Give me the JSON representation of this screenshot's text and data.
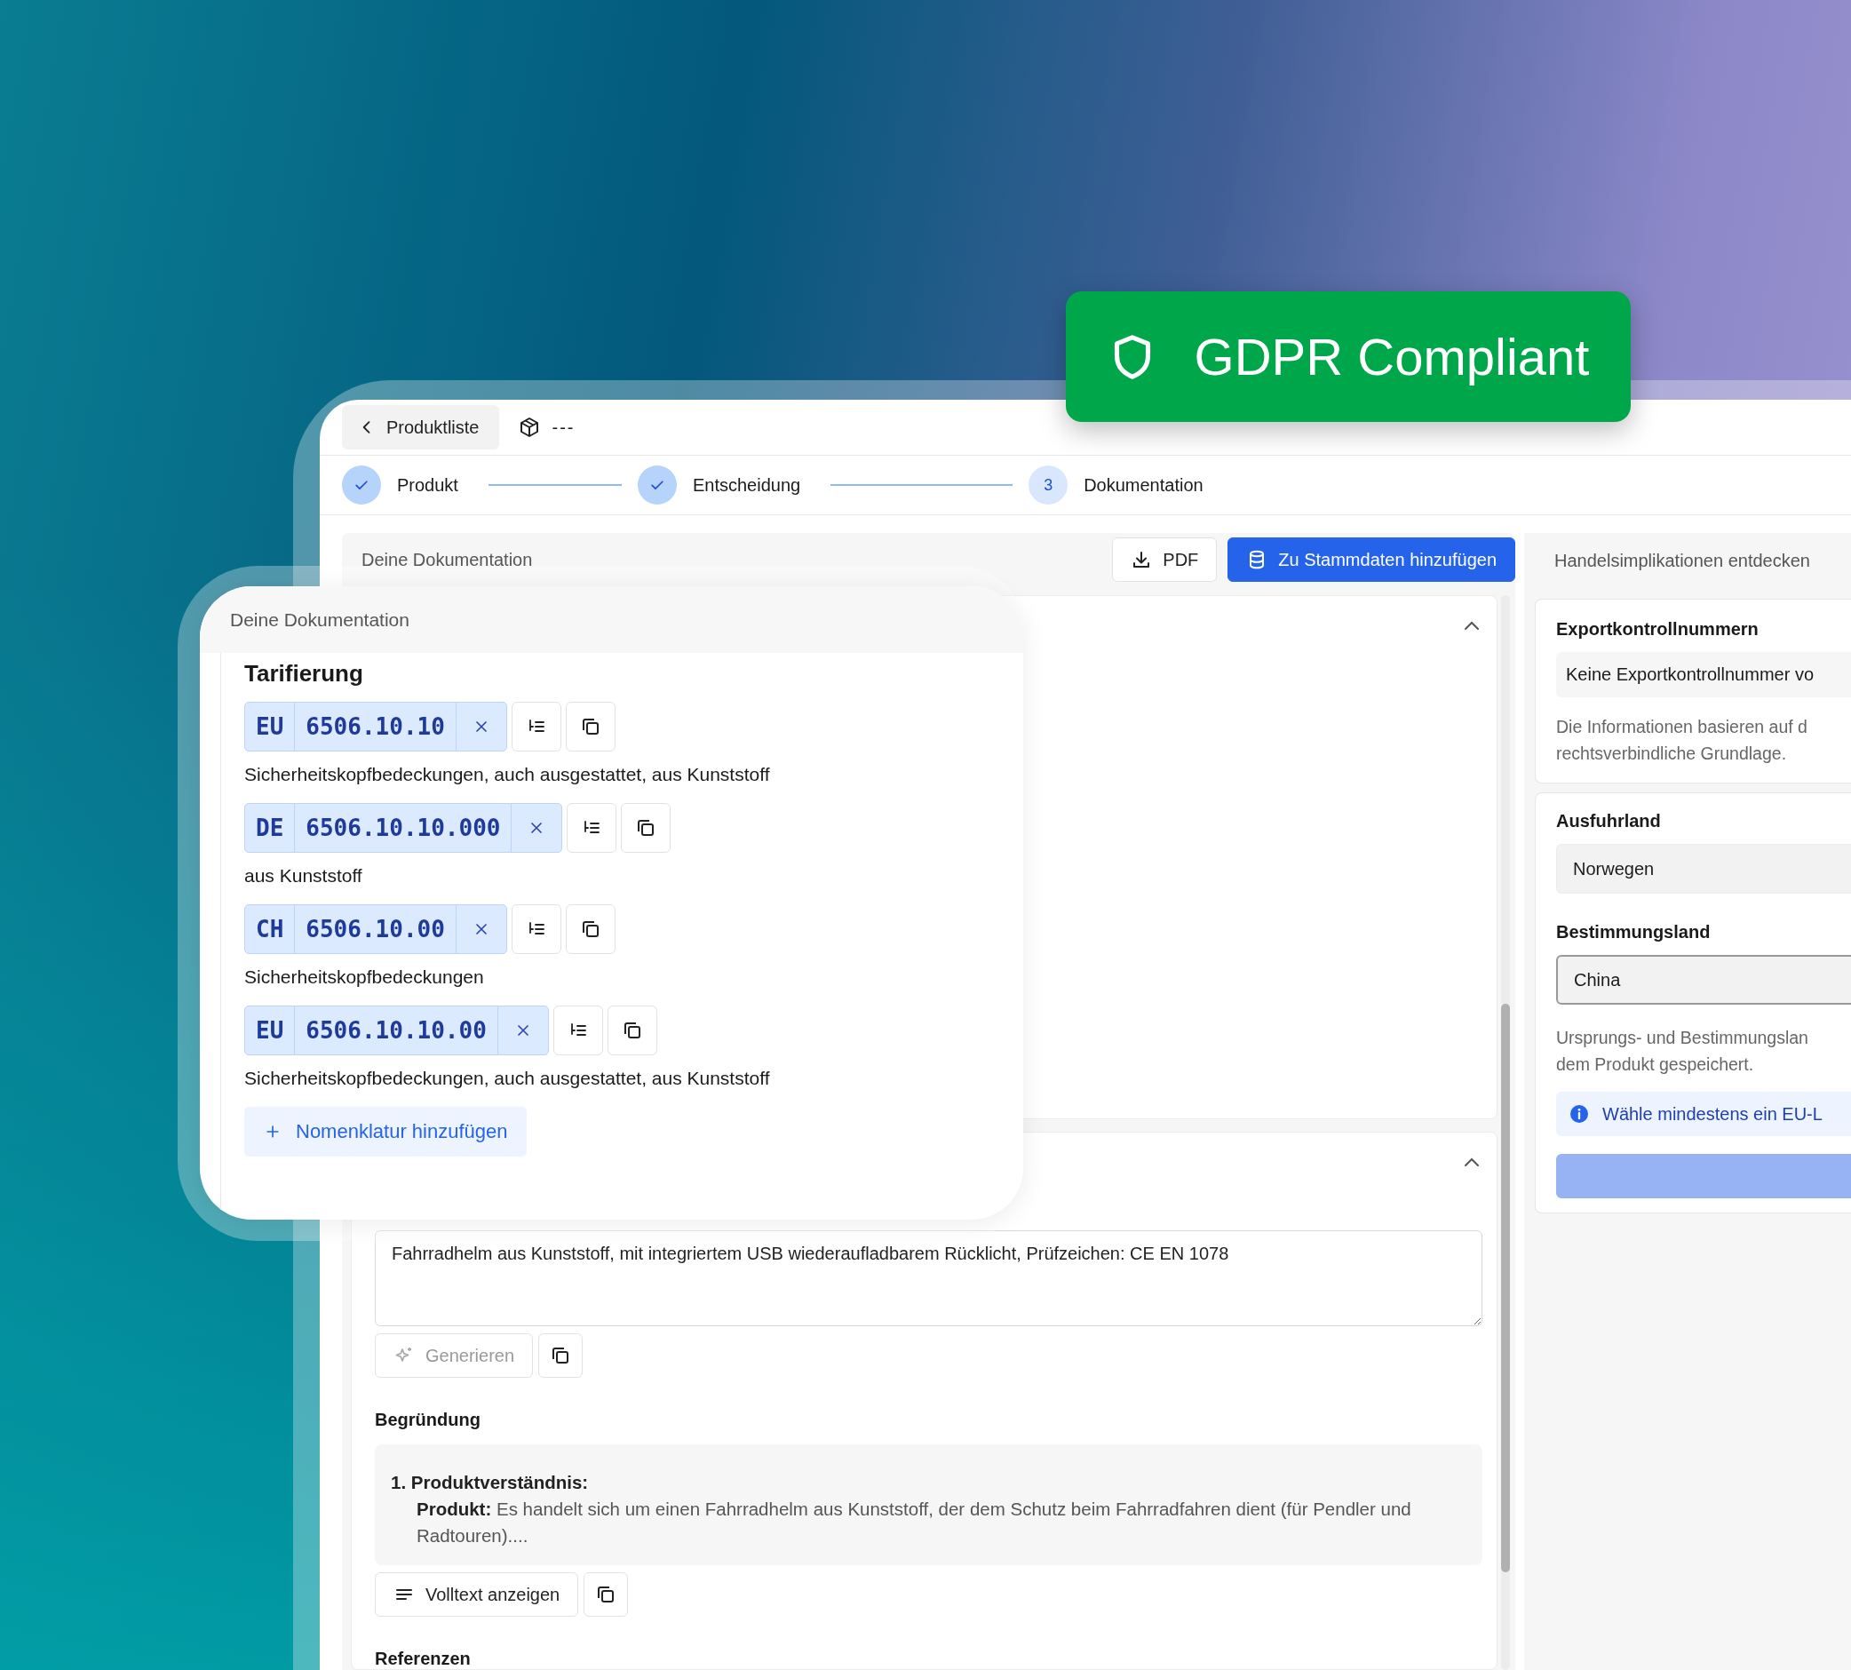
{
  "badge": {
    "label": "GDPR Compliant"
  },
  "header": {
    "back_label": "Produktliste",
    "product_name": "---"
  },
  "stepper": [
    {
      "label": "Produkt",
      "done": true
    },
    {
      "label": "Entscheidung",
      "done": true
    },
    {
      "label": "Dokumentation",
      "done": false,
      "number": "3"
    }
  ],
  "documentation": {
    "title": "Deine Dokumentation",
    "pdf_button": "PDF",
    "save_button": "Zu Stammdaten hinzufügen",
    "description_field": {
      "value": "Fahrradhelm aus Kunststoff, mit integriertem USB wiederaufladbarem Rücklicht, Prüfzeichen: CE EN 1078"
    },
    "generate_button": {
      "label": "Generieren",
      "disabled": true
    },
    "reasoning": {
      "label": "Begründung",
      "heading": "1. Produktverständnis:",
      "text": "**Produkt:** Es handelt sich um einen Fahrradhelm aus Kunststoff, der dem Schutz beim Fahrradfahren dient (für Pendler und Radtouren)....",
      "show_full_button": "Volltext anzeigen"
    },
    "references_label": "Referenzen"
  },
  "overlay": {
    "title": "Deine Dokumentation",
    "section_title": "Tarifierung",
    "codes": [
      {
        "region": "EU",
        "code": "6506.10.10",
        "description": "Sicherheitskopfbedeckungen, auch ausgestattet, aus Kunststoff"
      },
      {
        "region": "DE",
        "code": "6506.10.10.000",
        "description": "aus Kunststoff"
      },
      {
        "region": "CH",
        "code": "6506.10.00",
        "description": "Sicherheitskopfbedeckungen"
      },
      {
        "region": "EU",
        "code": "6506.10.10.00",
        "description": "Sicherheitskopfbedeckungen, auch ausgestattet, aus Kunststoff"
      }
    ],
    "add_button": "Nomenklatur hinzufügen"
  },
  "side_panel": {
    "title": "Handelsimplikationen entdecken",
    "export_control": {
      "label": "Exportkontrollnummern",
      "value": "Keine Exportkontrollnummer vo",
      "note_lines": [
        "Die Informationen basieren auf d",
        "rechtsverbindliche Grundlage."
      ]
    },
    "countries": [
      {
        "label": "Ausfuhrland",
        "value": "Norwegen",
        "disabled": true
      },
      {
        "label": "Bestimmungsland",
        "value": "China",
        "disabled": false
      }
    ],
    "country_note_lines": [
      "Ursprungs- und Bestimmungslan",
      "dem Produkt gespeichert."
    ],
    "info": "Wähle mindestens ein EU-L",
    "submit_button": {
      "disabled": true
    }
  }
}
